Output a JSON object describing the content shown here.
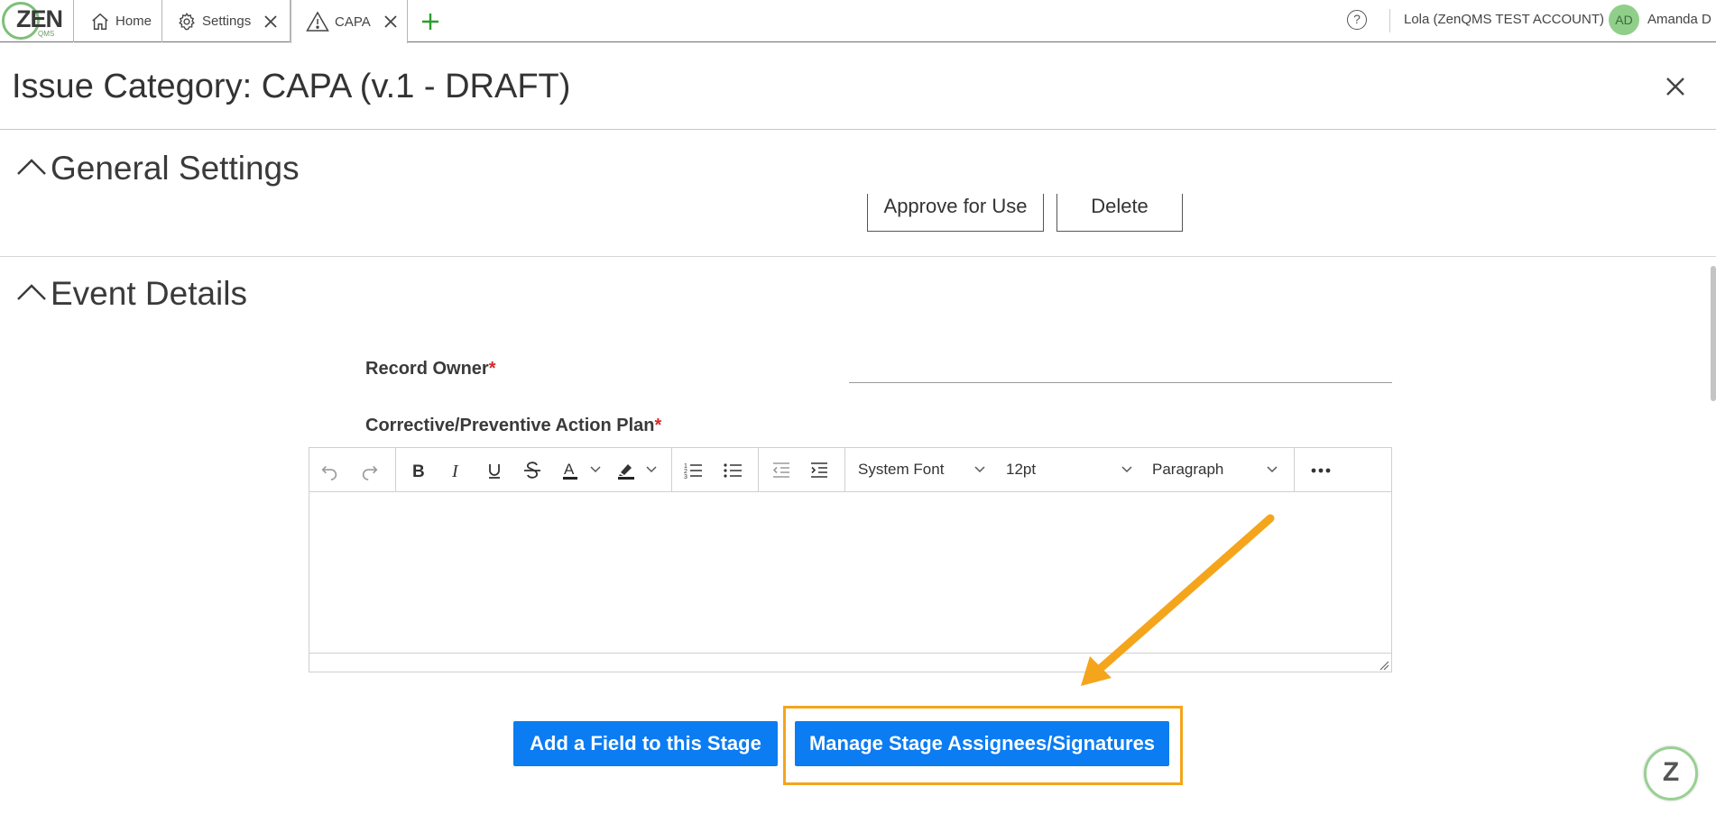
{
  "app": {
    "logo_text": "ZEN",
    "logo_sub": "QMS"
  },
  "tabs": [
    {
      "label": "Home",
      "icon": "home-icon",
      "closable": false
    },
    {
      "label": "Settings",
      "icon": "gear-icon",
      "closable": true
    },
    {
      "label": "CAPA",
      "icon": "warning-icon",
      "closable": true,
      "active": true
    }
  ],
  "header": {
    "help_symbol": "?",
    "account": "Lola (ZenQMS TEST ACCOUNT)",
    "avatar_initials": "AD",
    "user_name": "Amanda D"
  },
  "page": {
    "title": "Issue Category: CAPA (v.1 - DRAFT)"
  },
  "general_settings": {
    "title": "General Settings",
    "approve_label": "Approve for Use",
    "delete_label": "Delete"
  },
  "event_details": {
    "title": "Event Details",
    "record_owner_label": "Record Owner",
    "plan_label": "Corrective/Preventive Action Plan",
    "required_marker": "*"
  },
  "editor": {
    "font_family": "System Font",
    "font_size": "12pt",
    "block_format": "Paragraph"
  },
  "actions": {
    "add_field_label": "Add a Field to this Stage",
    "manage_label": "Manage Stage Assignees/Signatures"
  },
  "badge": {
    "letter": "Z"
  },
  "colors": {
    "primary": "#0b7cf2",
    "highlight": "#f4a51c",
    "brand_green": "#7fbf7a",
    "required": "#d62828"
  }
}
